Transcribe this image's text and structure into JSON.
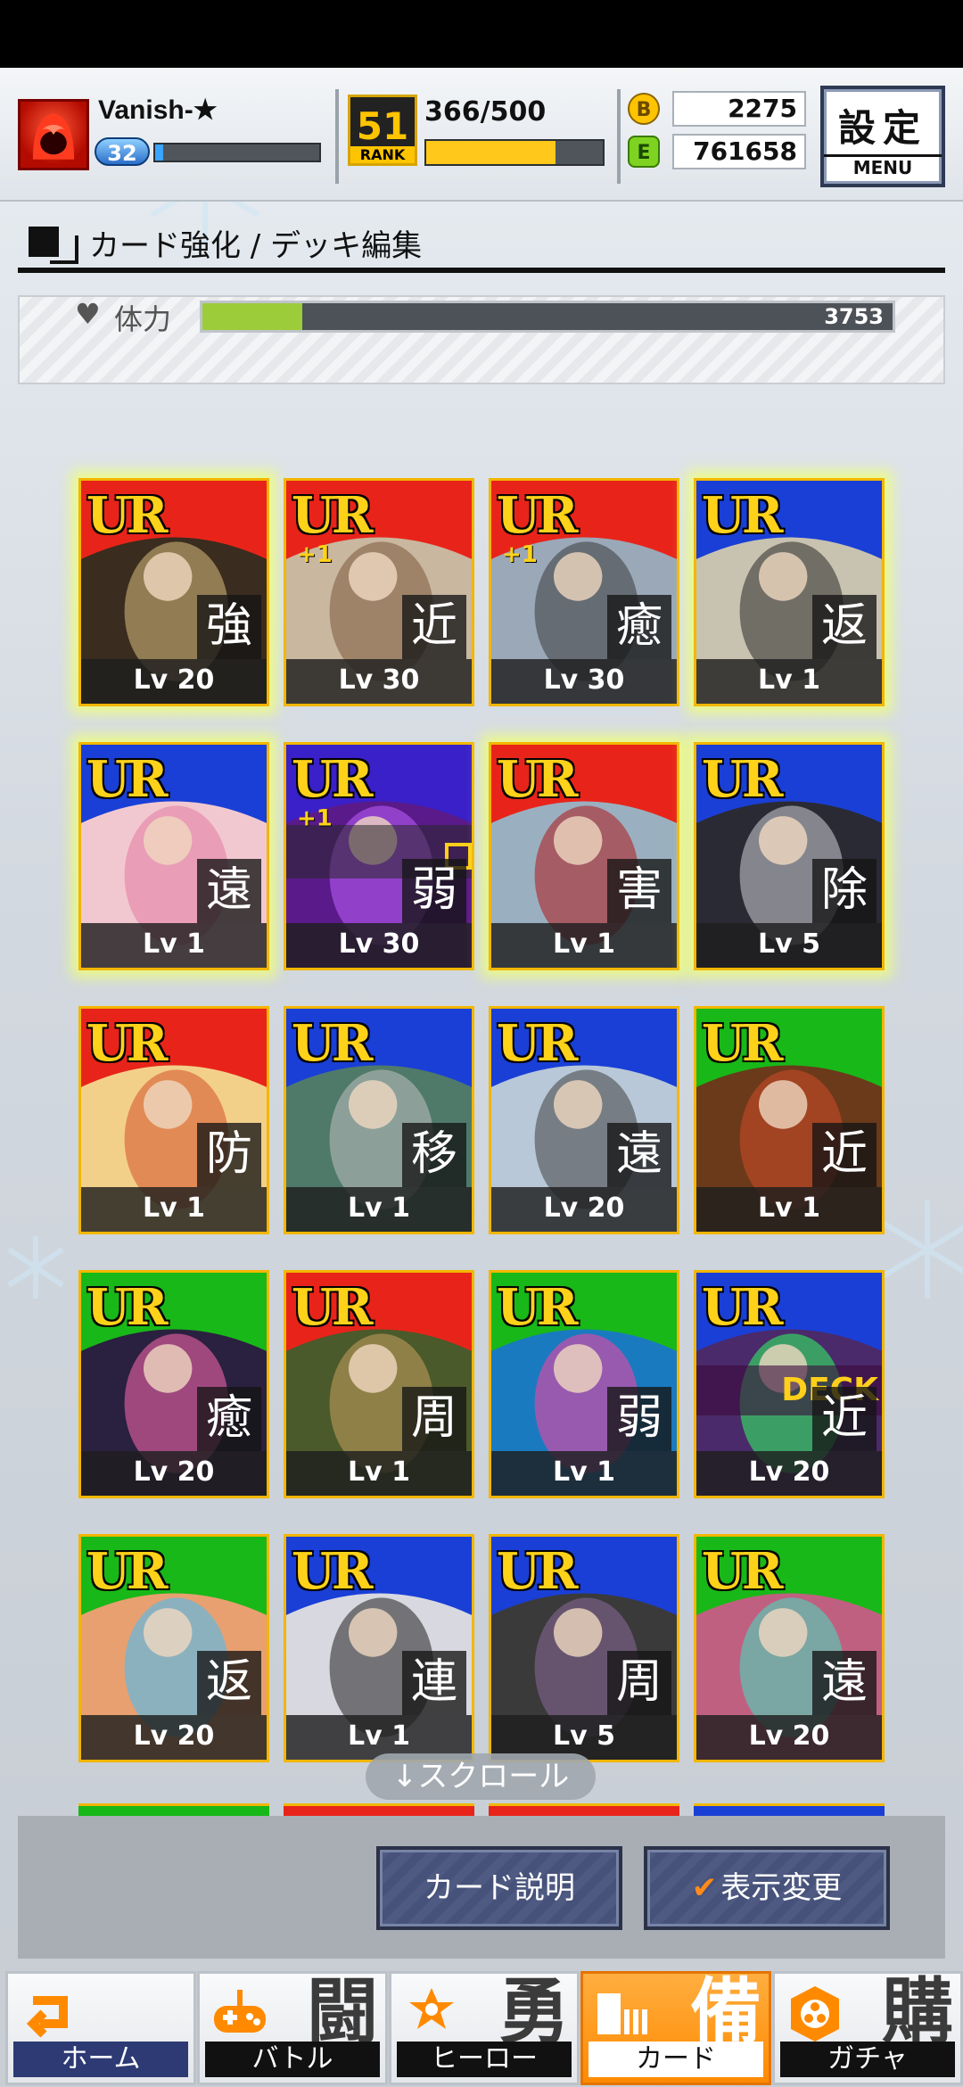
{
  "player": {
    "name": "Vanish-★",
    "level": "32",
    "exp_fraction": 0.05
  },
  "rank": {
    "number": "51",
    "label": "RANK"
  },
  "stamina": {
    "text": "366/500",
    "fraction": 0.732
  },
  "currency": {
    "coins": "2275",
    "coin_letter": "B",
    "energy": "761658",
    "energy_letter": "E"
  },
  "settings": {
    "label": "設定",
    "sublabel": "MENU"
  },
  "page_title": "カード強化 / デッキ編集",
  "stat": {
    "label": "体力",
    "value": "3753",
    "fraction": 0.145
  },
  "cards": [
    {
      "rarity": "UR",
      "type": "強",
      "level": "Lv 20",
      "plus": "",
      "glow": true,
      "top": "#e8241a",
      "art": "#3a2c1e",
      "accent": "#d9c080",
      "deck": false
    },
    {
      "rarity": "UR",
      "type": "近",
      "level": "Lv 30",
      "plus": "+1",
      "glow": false,
      "top": "#e8241a",
      "art": "#c9b7a0",
      "accent": "#7a5a3a",
      "deck": false
    },
    {
      "rarity": "UR",
      "type": "癒",
      "level": "Lv 30",
      "plus": "+1",
      "glow": false,
      "top": "#e8241a",
      "art": "#9aa8b8",
      "accent": "#3a3a3a",
      "deck": false
    },
    {
      "rarity": "UR",
      "type": "返",
      "level": "Lv 1",
      "plus": "",
      "glow": true,
      "top": "#1a3fd6",
      "art": "#c8c2b0",
      "accent": "#2a2a2a",
      "deck": false
    },
    {
      "rarity": "UR",
      "type": "遠",
      "level": "Lv 1",
      "plus": "",
      "glow": true,
      "top": "#1a3fd6",
      "art": "#f2c8d0",
      "accent": "#e27aa0",
      "deck": false
    },
    {
      "rarity": "UR",
      "type": "弱",
      "level": "Lv 30",
      "plus": "+1",
      "glow": false,
      "top": "#3a20c8",
      "art": "#5a1a8a",
      "accent": "#c060ff",
      "deck": false,
      "marker": true
    },
    {
      "rarity": "UR",
      "type": "害",
      "level": "Lv 1",
      "plus": "",
      "glow": true,
      "top": "#e8241a",
      "art": "#9ab0c0",
      "accent": "#b01818",
      "deck": false
    },
    {
      "rarity": "UR",
      "type": "除",
      "level": "Lv 5",
      "plus": "",
      "glow": true,
      "top": "#1a3fd6",
      "art": "#2a2a34",
      "accent": "#d0d0d8",
      "deck": false
    },
    {
      "rarity": "UR",
      "type": "防",
      "level": "Lv 1",
      "plus": "",
      "glow": false,
      "top": "#e8241a",
      "art": "#f3d08a",
      "accent": "#d4502a",
      "deck": false
    },
    {
      "rarity": "UR",
      "type": "移",
      "level": "Lv 1",
      "plus": "",
      "glow": false,
      "top": "#1a3fd6",
      "art": "#4f7a6a",
      "accent": "#c0c0c0",
      "deck": false
    },
    {
      "rarity": "UR",
      "type": "遠",
      "level": "Lv 20",
      "plus": "",
      "glow": false,
      "top": "#1a3fd6",
      "art": "#b8c8d8",
      "accent": "#404040",
      "deck": false
    },
    {
      "rarity": "UR",
      "type": "近",
      "level": "Lv 1",
      "plus": "",
      "glow": false,
      "top": "#18b818",
      "art": "#6a3a1a",
      "accent": "#d04a2a",
      "deck": false
    },
    {
      "rarity": "UR",
      "type": "癒",
      "level": "Lv 20",
      "plus": "",
      "glow": false,
      "top": "#18b818",
      "art": "#2a2040",
      "accent": "#ff6ab0",
      "deck": false
    },
    {
      "rarity": "UR",
      "type": "周",
      "level": "Lv 1",
      "plus": "",
      "glow": false,
      "top": "#e8241a",
      "art": "#4a5a2a",
      "accent": "#c8a060",
      "deck": false
    },
    {
      "rarity": "UR",
      "type": "弱",
      "level": "Lv 1",
      "plus": "",
      "glow": false,
      "top": "#18b818",
      "art": "#1a7ac0",
      "accent": "#ff40a0",
      "deck": false
    },
    {
      "rarity": "UR",
      "type": "近",
      "level": "Lv 20",
      "plus": "",
      "glow": false,
      "top": "#1a3fd6",
      "art": "#4a2a6a",
      "accent": "#30ff60",
      "deck": true
    },
    {
      "rarity": "UR",
      "type": "返",
      "level": "Lv 20",
      "plus": "",
      "glow": false,
      "top": "#18b818",
      "art": "#e8a070",
      "accent": "#40c0ff",
      "deck": false
    },
    {
      "rarity": "UR",
      "type": "連",
      "level": "Lv 1",
      "plus": "",
      "glow": false,
      "top": "#1a3fd6",
      "art": "#d8d8e0",
      "accent": "#202020",
      "deck": false
    },
    {
      "rarity": "UR",
      "type": "周",
      "level": "Lv 5",
      "plus": "",
      "glow": false,
      "top": "#1a3fd6",
      "art": "#3a3a3a",
      "accent": "#8a6a9a",
      "deck": false
    },
    {
      "rarity": "UR",
      "type": "遠",
      "level": "Lv 20",
      "plus": "",
      "glow": false,
      "top": "#18b818",
      "art": "#c06080",
      "accent": "#40e0c0",
      "deck": false
    }
  ],
  "deck_label": "DECK",
  "peek_colors": [
    "#18b818",
    "#e8241a",
    "#e8241a",
    "#1a3fd6"
  ],
  "scroll_hint": "↓スクロール",
  "actions": {
    "card_info": "カード説明",
    "display_change": "表示変更",
    "check_mark": "✔"
  },
  "nav": [
    {
      "label": "ホーム",
      "big": "",
      "icon": "home-icon",
      "active": false
    },
    {
      "label": "バトル",
      "big": "闘",
      "icon": "gamepad-icon",
      "active": false
    },
    {
      "label": "ヒーロー",
      "big": "勇",
      "icon": "hero-icon",
      "active": false
    },
    {
      "label": "カード",
      "big": "備",
      "icon": "cards-icon",
      "active": true
    },
    {
      "label": "ガチャ",
      "big": "購",
      "icon": "gacha-icon",
      "active": false
    }
  ],
  "colors": {
    "accent_orange": "#ff8a00",
    "gold": "#ffc400",
    "hp_green": "#9ccc3a",
    "button_navy": "#4e5a82"
  }
}
